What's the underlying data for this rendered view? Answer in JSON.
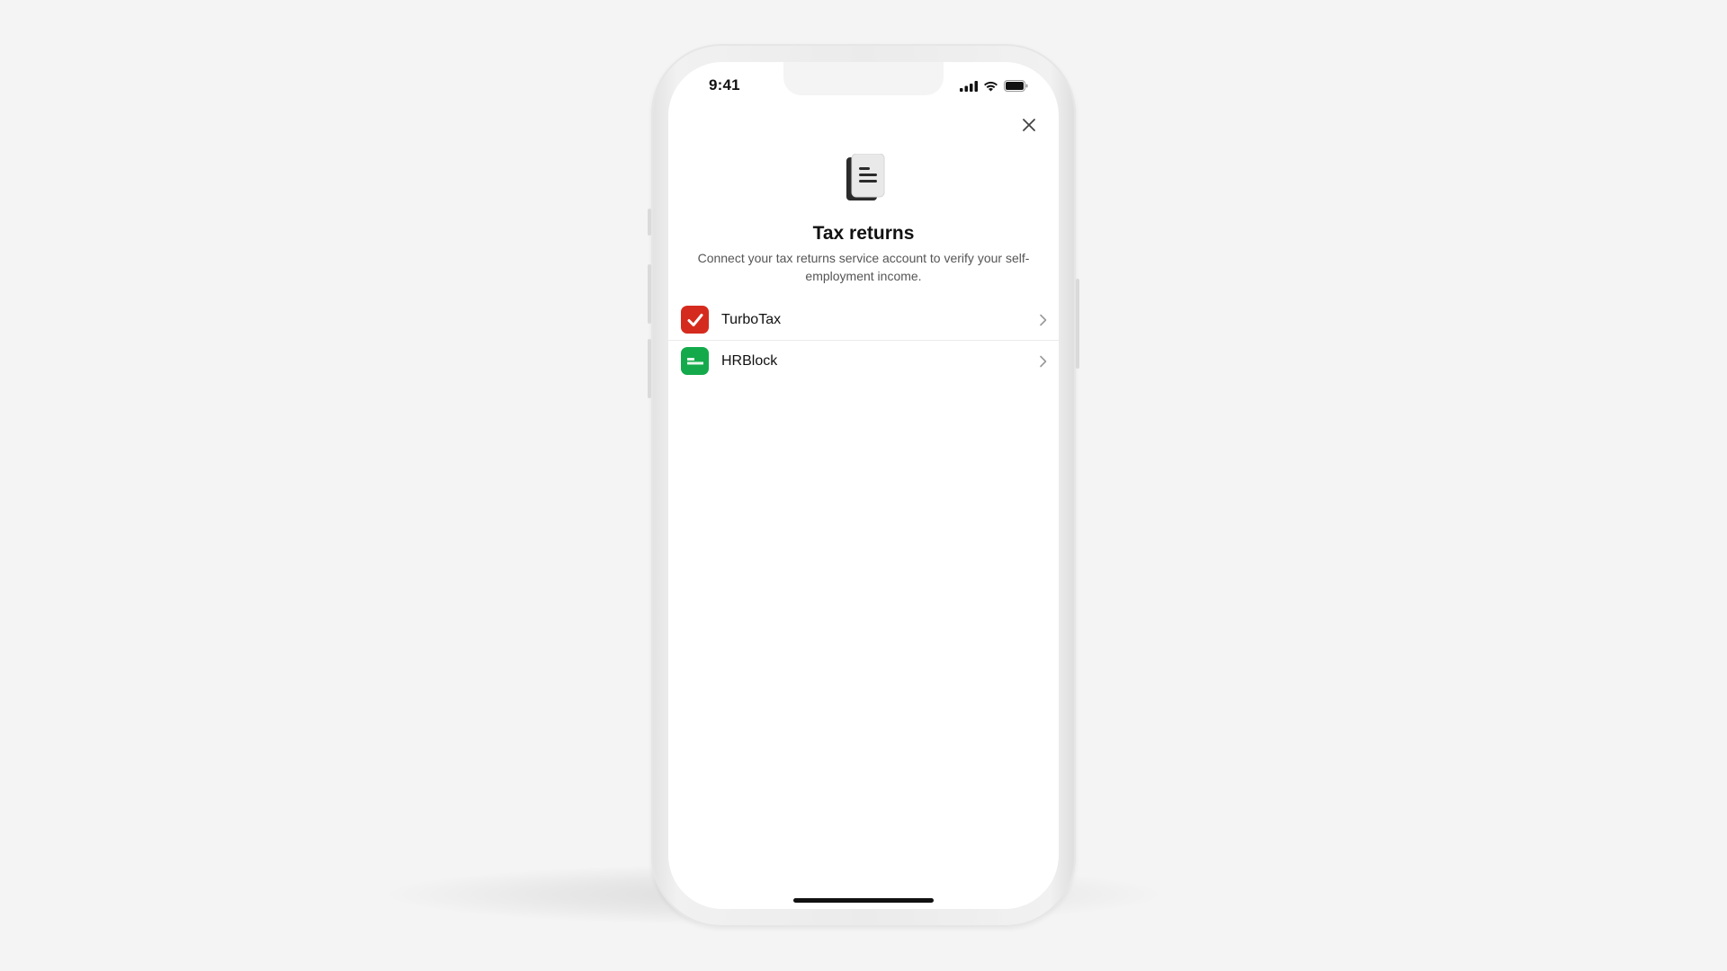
{
  "status_bar": {
    "time": "9:41",
    "icons": [
      "signal-icon",
      "wifi-icon",
      "battery-icon"
    ]
  },
  "header": {
    "close_icon": "close-icon",
    "hero_icon": "document-icon",
    "title": "Tax returns",
    "subtitle": "Connect your tax returns service account to verify your self-employment income."
  },
  "providers": [
    {
      "label": "TurboTax",
      "icon": "turbotax-logo-icon",
      "color": "#d52b1e"
    },
    {
      "label": "HRBlock",
      "icon": "hrblock-logo-icon",
      "color": "#14aa4b"
    }
  ],
  "colors": {
    "background": "#f4f4f4",
    "screen": "#ffffff",
    "text_primary": "#111111",
    "text_secondary": "#555555"
  }
}
